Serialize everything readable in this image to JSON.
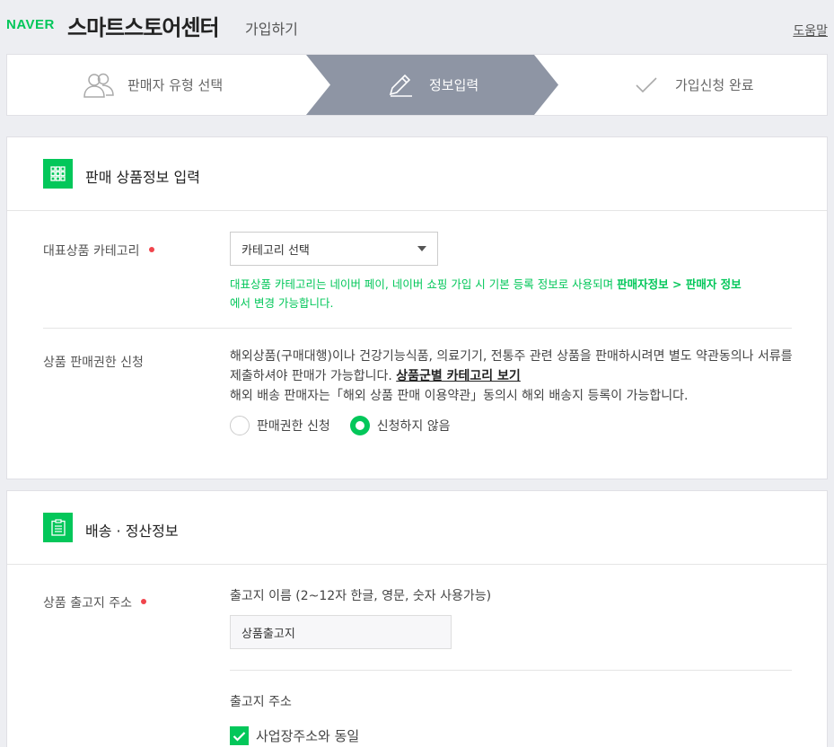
{
  "header": {
    "logo": "NAVER",
    "brand": "스마트스토어센터",
    "subtitle": "가입하기",
    "help": "도움말"
  },
  "steps": [
    {
      "label": "판매자 유형 선택",
      "icon": "users-icon",
      "active": false
    },
    {
      "label": "정보입력",
      "icon": "pencil-icon",
      "active": true
    },
    {
      "label": "가입신청 완료",
      "icon": "check-icon",
      "active": false
    }
  ],
  "colors": {
    "accent": "#03c75a",
    "active_step": "#8e95a4",
    "required_dot": "#f0444c"
  },
  "product_section": {
    "title": "판매 상품정보 입력",
    "icon": "grid-icon",
    "category": {
      "label": "대표상품 카테고리",
      "select_value": "카테고리 선택",
      "note_1": "대표상품 카테고리는 네이버 페이, 네이버 쇼핑 가입 시 기본 등록 정보로 사용되며 ",
      "note_bold": "판매자정보 > 판매자 정보",
      "note_2": "에서 변경 가능합니다."
    },
    "permission": {
      "label": "상품 판매권한 신청",
      "text_1": "해외상품(구매대행)이나 건강기능식품, 의료기기, 전통주 관련 상품을 판매하시려면 별도 약관동의나 서류를 제출하셔야 판매가 가능합니다. ",
      "link": "상품군별 카테고리 보기",
      "text_2": "해외 배송 판매자는「해외 상품 판매 이용약관」동의시 해외 배송지 등록이 가능합니다.",
      "option_apply": "판매권한 신청",
      "option_none": "신청하지 않음",
      "selected": "신청하지 않음"
    }
  },
  "shipping_section": {
    "title": "배송 · 정산정보",
    "icon": "clipboard-icon",
    "address": {
      "label": "상품 출고지 주소",
      "name_label": "출고지 이름 (2~12자 한글, 영문, 숫자 사용가능)",
      "name_value": "상품출고지",
      "address_label": "출고지 주소",
      "same_checkbox": "사업장주소와 동일",
      "same_checked": true
    }
  }
}
